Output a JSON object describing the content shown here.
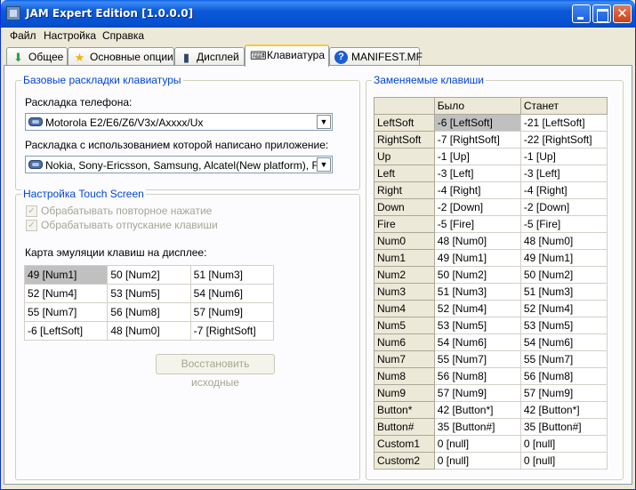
{
  "window": {
    "title": "JAM Expert Edition [1.0.0.0]",
    "close_glyph": "✕"
  },
  "menu": [
    "Файл",
    "Настройка",
    "Справка"
  ],
  "tabs": [
    {
      "label": "Общее",
      "icon": "download-arrow-icon",
      "glyph": "⬇",
      "color": "#2ea043"
    },
    {
      "label": "Основные опции",
      "icon": "star-icon",
      "glyph": "★",
      "color": "#e8b800"
    },
    {
      "label": "Дисплей",
      "icon": "phone-icon",
      "glyph": "▮",
      "color": "#334466"
    },
    {
      "label": "Клавиатура",
      "icon": "keyboard-icon",
      "glyph": "⌨",
      "color": "#333333",
      "active": true
    },
    {
      "label": "MANIFEST.MF",
      "icon": "help-icon",
      "glyph": "?",
      "color": "#1a5fd0"
    }
  ],
  "base_layouts": {
    "title": "Базовые раскладки клавиатуры",
    "phone_label": "Раскладка телефона:",
    "phone_value": "Motorola E2/E6/Z6/V3x/Axxxx/Ux",
    "app_label": "Раскладка с использованием которой написано приложение:",
    "app_value": "Nokia, Sony-Ericsson, Samsung, Alcatel(New platform), Fly"
  },
  "touch": {
    "title": "Настройка Touch Screen",
    "repeat_label": "Обрабатывать повторное нажатие",
    "release_label": "Обрабатывать отпускание клавиши",
    "map_label": "Карта эмуляции клавиш на дисплее:",
    "grid": [
      [
        "49 [Num1]",
        "50 [Num2]",
        "51 [Num3]"
      ],
      [
        "52 [Num4]",
        "53 [Num5]",
        "54 [Num6]"
      ],
      [
        "55 [Num7]",
        "56 [Num8]",
        "57 [Num9]"
      ],
      [
        "-6 [LeftSoft]",
        "48 [Num0]",
        "-7 [RightSoft]"
      ]
    ],
    "restore_label": "Восстановить исходные"
  },
  "remap": {
    "title": "Заменяемые клавиши",
    "col_was": "Было",
    "col_will": "Станет",
    "rows": [
      {
        "key": "LeftSoft",
        "was": "-6 [LeftSoft]",
        "will": "-21 [LeftSoft]"
      },
      {
        "key": "RightSoft",
        "was": "-7 [RightSoft]",
        "will": "-22 [RightSoft]"
      },
      {
        "key": "Up",
        "was": "-1 [Up]",
        "will": "-1 [Up]"
      },
      {
        "key": "Left",
        "was": "-3 [Left]",
        "will": "-3 [Left]"
      },
      {
        "key": "Right",
        "was": "-4 [Right]",
        "will": "-4 [Right]"
      },
      {
        "key": "Down",
        "was": "-2 [Down]",
        "will": "-2 [Down]"
      },
      {
        "key": "Fire",
        "was": "-5 [Fire]",
        "will": "-5 [Fire]"
      },
      {
        "key": "Num0",
        "was": "48 [Num0]",
        "will": "48 [Num0]"
      },
      {
        "key": "Num1",
        "was": "49 [Num1]",
        "will": "49 [Num1]"
      },
      {
        "key": "Num2",
        "was": "50 [Num2]",
        "will": "50 [Num2]"
      },
      {
        "key": "Num3",
        "was": "51 [Num3]",
        "will": "51 [Num3]"
      },
      {
        "key": "Num4",
        "was": "52 [Num4]",
        "will": "52 [Num4]"
      },
      {
        "key": "Num5",
        "was": "53 [Num5]",
        "will": "53 [Num5]"
      },
      {
        "key": "Num6",
        "was": "54 [Num6]",
        "will": "54 [Num6]"
      },
      {
        "key": "Num7",
        "was": "55 [Num7]",
        "will": "55 [Num7]"
      },
      {
        "key": "Num8",
        "was": "56 [Num8]",
        "will": "56 [Num8]"
      },
      {
        "key": "Num9",
        "was": "57 [Num9]",
        "will": "57 [Num9]"
      },
      {
        "key": "Button*",
        "was": "42 [Button*]",
        "will": "42 [Button*]"
      },
      {
        "key": "Button#",
        "was": "35 [Button#]",
        "will": "35 [Button#]"
      },
      {
        "key": "Custom1",
        "was": "0 [null]",
        "will": "0 [null]"
      },
      {
        "key": "Custom2",
        "was": "0 [null]",
        "will": "0 [null]"
      }
    ]
  }
}
